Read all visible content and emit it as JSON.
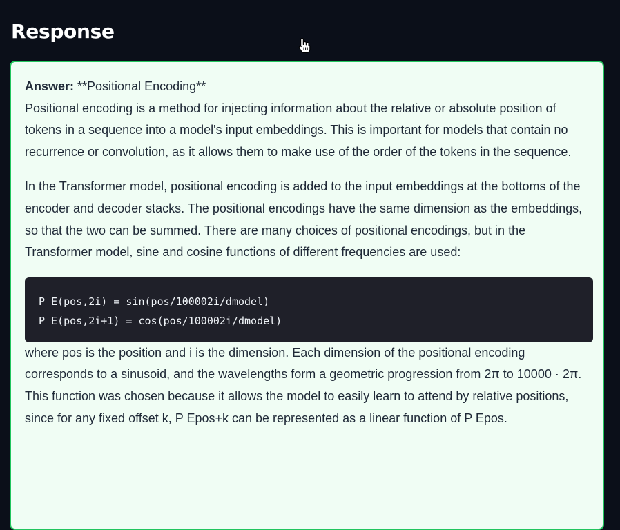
{
  "header": {
    "title": "Response"
  },
  "answer": {
    "label": "Answer:",
    "heading": "**Positional Encoding**",
    "paragraph1": "Positional encoding is a method for injecting information about the relative or absolute position of tokens in a sequence into a model's input embeddings. This is important for models that contain no recurrence or convolution, as it allows them to make use of the order of the tokens in the sequence.",
    "paragraph2": "In the Transformer model, positional encoding is added to the input embeddings at the bottoms of the encoder and decoder stacks. The positional encodings have the same dimension as the embeddings, so that the two can be summed. There are many choices of positional encodings, but in the Transformer model, sine and cosine functions of different frequencies are used:",
    "code_lines": [
      "P E(pos,2i) = sin(pos/100002i/dmodel)",
      "P E(pos,2i+1) = cos(pos/100002i/dmodel)"
    ],
    "paragraph3": "where pos is the position and i is the dimension. Each dimension of the positional encoding corresponds to a sinusoid, and the wavelengths form a geometric progression from 2π to 10000 · 2π. This function was chosen because it allows the model to easily learn to attend by relative positions, since for any fixed offset k, P Epos+k can be represented as a linear function of P Epos."
  },
  "colors": {
    "page_background": "#0b0f19",
    "panel_background": "#f0fdf4",
    "panel_border": "#22c55e",
    "code_background": "#1f2029"
  },
  "icons": {
    "cursor": "hand-pointer-cursor-icon"
  }
}
